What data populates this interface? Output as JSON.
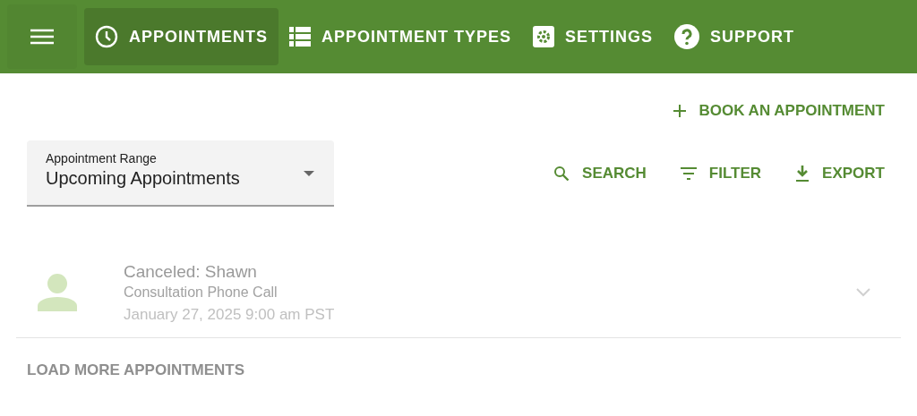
{
  "nav": {
    "tabs": [
      {
        "kind": "clock",
        "label": "APPOINTMENTS",
        "selected": true
      },
      {
        "kind": "list",
        "label": "APPOINTMENT TYPES",
        "selected": false
      },
      {
        "kind": "gear",
        "label": "SETTINGS",
        "selected": false
      },
      {
        "kind": "help",
        "label": "SUPPORT",
        "selected": false
      }
    ]
  },
  "book_button": {
    "kind": "plus",
    "label": "BOOK AN APPOINTMENT"
  },
  "range_select": {
    "label": "Appointment Range",
    "value": "Upcoming Appointments"
  },
  "actions": [
    {
      "kind": "search",
      "label": "SEARCH"
    },
    {
      "kind": "filter",
      "label": "FILTER"
    },
    {
      "kind": "download",
      "label": "EXPORT"
    }
  ],
  "appointments": [
    {
      "title": "Canceled: Shawn",
      "type": "Consultation Phone Call",
      "time": "January 27, 2025 9:00 am PST",
      "canceled": true
    }
  ],
  "load_more": "LOAD MORE APPOINTMENTS"
}
